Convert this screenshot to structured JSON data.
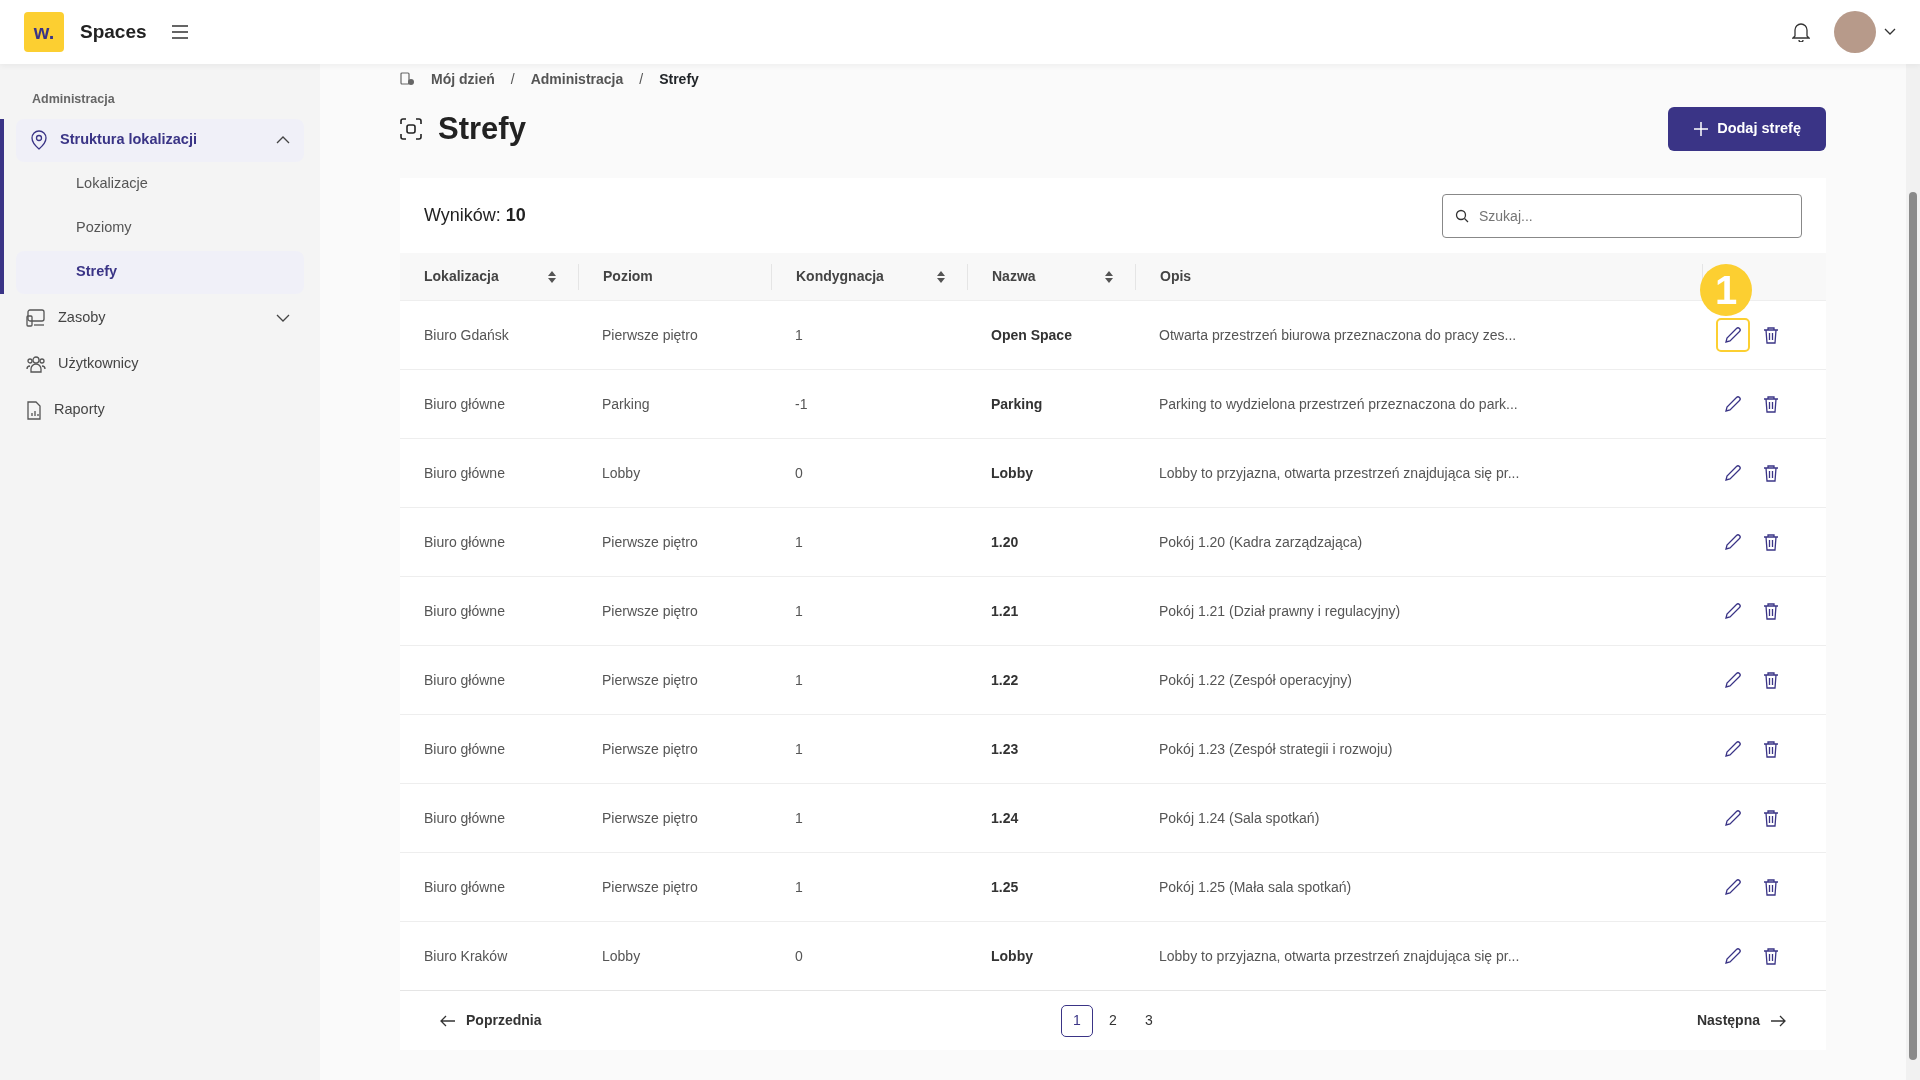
{
  "header": {
    "logo": "w.",
    "app_name": "Spaces"
  },
  "sidebar": {
    "section": "Administracja",
    "items": [
      {
        "label": "Struktura lokalizacji",
        "selected": true,
        "expanded": true,
        "children": [
          {
            "label": "Lokalizacje",
            "selected": false
          },
          {
            "label": "Poziomy",
            "selected": false
          },
          {
            "label": "Strefy",
            "selected": true
          }
        ]
      },
      {
        "label": "Zasoby",
        "selected": false,
        "expanded": false
      },
      {
        "label": "Użytkownicy",
        "selected": false
      },
      {
        "label": "Raporty",
        "selected": false
      }
    ]
  },
  "breadcrumb": {
    "separator": "/",
    "items": [
      "Mój dzień",
      "Administracja",
      "Strefy"
    ]
  },
  "title": "Strefy",
  "add_button": "Dodaj strefę",
  "results": {
    "label": "Wyników:",
    "count": "10"
  },
  "search": {
    "placeholder": "Szukaj..."
  },
  "table": {
    "columns": [
      {
        "label": "Lokalizacja",
        "sortable": true
      },
      {
        "label": "Poziom",
        "sortable": false
      },
      {
        "label": "Kondygnacja",
        "sortable": true
      },
      {
        "label": "Nazwa",
        "sortable": true
      },
      {
        "label": "Opis",
        "sortable": false
      }
    ],
    "rows": [
      {
        "cells": [
          "Biuro Gdańsk",
          "Pierwsze piętro",
          "1",
          "Open Space",
          "Otwarta przestrzeń biurowa przeznaczona do pracy zes..."
        ],
        "highlighted": true,
        "callout": "1"
      },
      {
        "cells": [
          "Biuro główne",
          "Parking",
          "-1",
          "Parking",
          "Parking to wydzielona przestrzeń przeznaczona do park..."
        ],
        "highlighted": false
      },
      {
        "cells": [
          "Biuro główne",
          "Lobby",
          "0",
          "Lobby",
          "Lobby to przyjazna, otwarta przestrzeń znajdująca się pr..."
        ],
        "highlighted": false
      },
      {
        "cells": [
          "Biuro główne",
          "Pierwsze piętro",
          "1",
          "1.20",
          "Pokój 1.20 (Kadra zarządzająca)"
        ],
        "highlighted": false
      },
      {
        "cells": [
          "Biuro główne",
          "Pierwsze piętro",
          "1",
          "1.21",
          "Pokój 1.21 (Dział prawny i regulacyjny)"
        ],
        "highlighted": false
      },
      {
        "cells": [
          "Biuro główne",
          "Pierwsze piętro",
          "1",
          "1.22",
          "Pokój 1.22 (Zespół operacyjny)"
        ],
        "highlighted": false
      },
      {
        "cells": [
          "Biuro główne",
          "Pierwsze piętro",
          "1",
          "1.23",
          "Pokój 1.23 (Zespół strategii i rozwoju)"
        ],
        "highlighted": false
      },
      {
        "cells": [
          "Biuro główne",
          "Pierwsze piętro",
          "1",
          "1.24",
          "Pokój 1.24 (Sala spotkań)"
        ],
        "highlighted": false
      },
      {
        "cells": [
          "Biuro główne",
          "Pierwsze piętro",
          "1",
          "1.25",
          "Pokój 1.25 (Mała sala spotkań)"
        ],
        "highlighted": false
      },
      {
        "cells": [
          "Biuro Kraków",
          "Lobby",
          "0",
          "Lobby",
          "Lobby to przyjazna, otwarta przestrzeń znajdująca się pr..."
        ],
        "highlighted": false
      }
    ]
  },
  "pagination": {
    "previous": "Poprzednia",
    "next": "Następna",
    "pages": [
      {
        "label": "1",
        "selected": true
      },
      {
        "label": "2",
        "selected": false
      },
      {
        "label": "3",
        "selected": false
      }
    ]
  }
}
